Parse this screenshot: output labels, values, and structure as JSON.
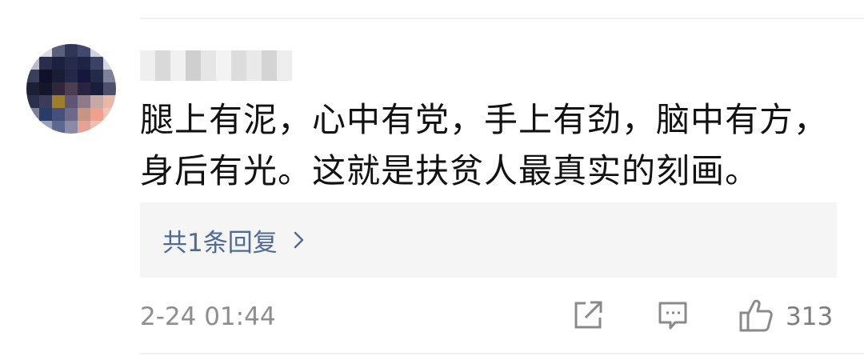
{
  "comment": {
    "author_name": "",
    "line1": "腿上有泥，心中有党，手上有劲，脑中有方，",
    "line2": "身后有光。这就是扶贫人最真实的刻画。",
    "replies_label": "共1条回复",
    "timestamp": "2-24 01:44",
    "like_count": "313"
  },
  "icons": {
    "share": "share-icon",
    "reply": "reply-icon",
    "like": "thumbs-up-icon",
    "chevron": "chevron-right-icon"
  },
  "colors": {
    "reply_link": "#4f6a95",
    "meta_text": "#8e8e8e",
    "reply_box_bg": "#f5f5f6"
  }
}
